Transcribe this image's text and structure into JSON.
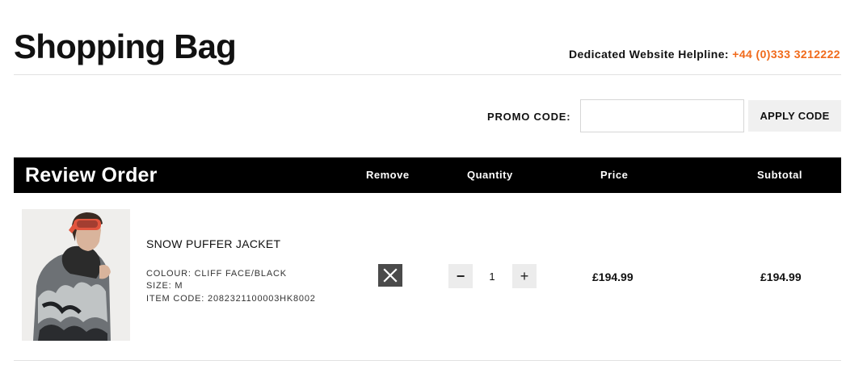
{
  "page": {
    "title": "Shopping Bag",
    "helpline_label": "Dedicated Website Helpline:",
    "helpline_phone": "+44 (0)333 3212222",
    "accent_color": "#f06a1b"
  },
  "promo": {
    "label": "PROMO CODE:",
    "input_value": "",
    "apply_label": "APPLY CODE"
  },
  "review": {
    "title": "Review Order",
    "columns": {
      "remove": "Remove",
      "quantity": "Quantity",
      "price": "Price",
      "subtotal": "Subtotal"
    }
  },
  "item": {
    "name": "SNOW PUFFER JACKET",
    "colour": "COLOUR: CLIFF FACE/BLACK",
    "size": "SIZE: M",
    "item_code": "ITEM CODE: 2082321100003HK8002",
    "quantity": "1",
    "price": "£194.99",
    "subtotal": "£194.99",
    "decrement_label": "−",
    "increment_label": "+"
  },
  "icons": {
    "remove": "close-icon",
    "decrement": "minus-icon",
    "increment": "plus-icon"
  }
}
